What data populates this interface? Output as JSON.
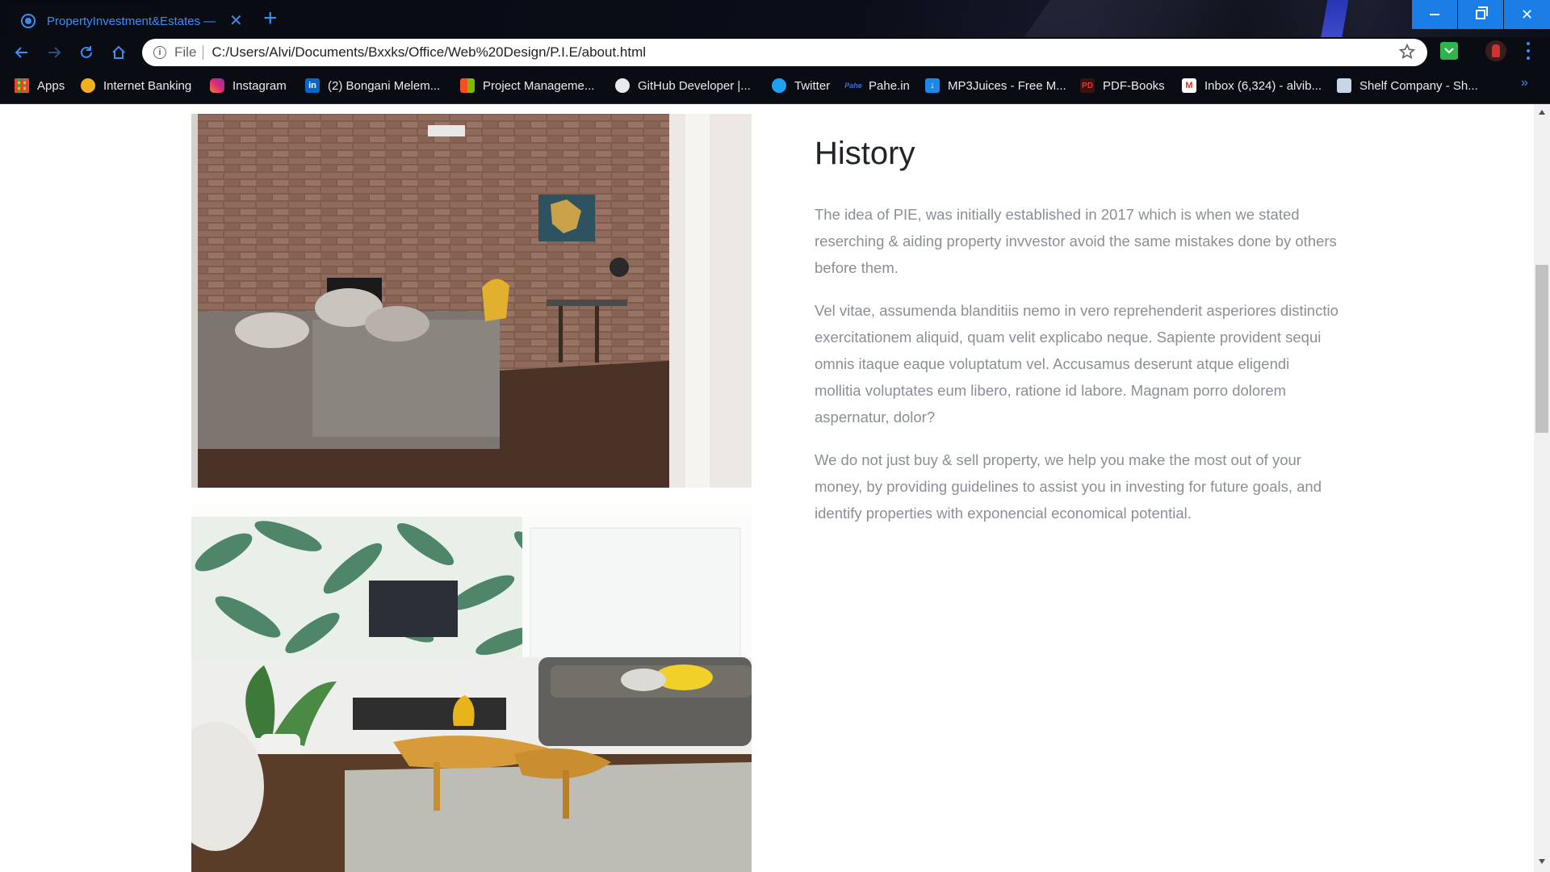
{
  "browser": {
    "tab_title": "PropertyInvestment&Estates — h",
    "address_scheme": "File",
    "address_url": "C:/Users/Alvi/Documents/Bxxks/Office/Web%20Design/P.I.E/about.html",
    "accent_color": "#3a8df5",
    "window_button_color": "#1a7ee6"
  },
  "bookmarks": [
    {
      "label": "Apps",
      "icon": "apps-grid-icon"
    },
    {
      "label": "Internet Banking",
      "icon": "bank-icon"
    },
    {
      "label": "Instagram",
      "icon": "instagram-icon"
    },
    {
      "label": "(2) Bongani Melem...",
      "icon": "linkedin-icon"
    },
    {
      "label": "Project Manageme...",
      "icon": "microsoft-icon"
    },
    {
      "label": "GitHub Developer |...",
      "icon": "github-icon"
    },
    {
      "label": "Twitter",
      "icon": "twitter-icon"
    },
    {
      "label": "Pahe.in",
      "icon": "pahe-icon"
    },
    {
      "label": "MP3Juices - Free M...",
      "icon": "download-icon"
    },
    {
      "label": "PDF-Books",
      "icon": "pdf-icon"
    },
    {
      "label": "Inbox (6,324) - alvib...",
      "icon": "gmail-icon"
    },
    {
      "label": "Shelf Company - Sh...",
      "icon": "site-icon"
    }
  ],
  "bookmarks_more": "»",
  "content": {
    "heading": "History",
    "paragraphs": [
      "The idea of PIE, was initially established in 2017 which is when we stated reserching & aiding property invvestor avoid the same mistakes done by others before them.",
      "Vel vitae, assumenda blanditiis nemo in vero reprehenderit asperiores distinctio exercitationem aliquid, quam velit explicabo neque. Sapiente provident sequi omnis itaque eaque voluptatum vel. Accusamus deserunt atque eligendi mollitia voluptates eum libero, ratione id labore. Magnam porro dolorem aspernatur, dolor?",
      "We do not just buy & sell property, we help you make the most out of your money, by providing guidelines to assist you in investing for future goals, and identify properties with exponencial economical potential."
    ],
    "images": [
      {
        "name": "brick-wall-living-room-photo"
      },
      {
        "name": "tropical-wallpaper-living-room-photo"
      }
    ]
  }
}
